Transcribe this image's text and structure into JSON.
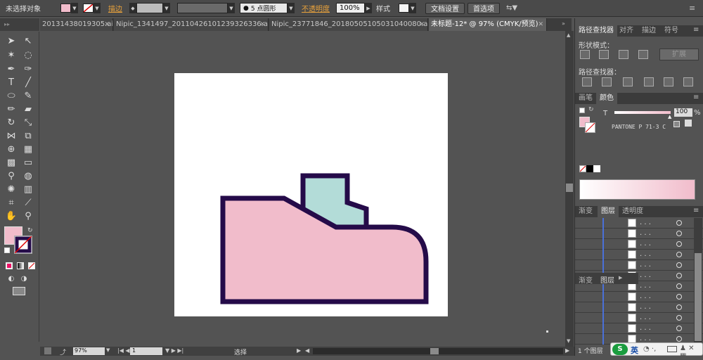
{
  "control_bar": {
    "selection": "未选择对象",
    "stroke_label": "描边",
    "brush": "5 点圆形",
    "opacity_label": "不透明度",
    "opacity_value": "100%",
    "style_label": "样式",
    "doc_settings": "文档设置",
    "preferences": "首选项"
  },
  "tabs": [
    {
      "label": "20131438019305.ai*"
    },
    {
      "label": "Nipic_1341497_20110426101239326336.ai*"
    },
    {
      "label": "Nipic_23771846_20180505105031040080.ai*"
    },
    {
      "label": "未标题-12* @ 97% (CMYK/预览)"
    }
  ],
  "status": {
    "zoom": "97%",
    "artboard": "1",
    "tool": "选择"
  },
  "panels": {
    "pathfinder": {
      "tabs": [
        "路径查找器",
        "对齐",
        "描边",
        "符号"
      ],
      "shape_modes": "形状模式：",
      "expand": "扩展",
      "pathfinders": "路径查找器："
    },
    "color": {
      "tabs": [
        "画笔",
        "颜色"
      ],
      "tint_label": "T",
      "tint_value": "100",
      "percent": "%",
      "swatch_name": "PANTONE P 71-3 C"
    },
    "layers": {
      "tabs": [
        "渐变",
        "图层",
        "透明度"
      ],
      "ghost_tabs": [
        "渐变",
        "图层"
      ],
      "count": "1 个图层",
      "row_text": ". . ."
    }
  },
  "ime": {
    "logo": "S",
    "lang": "英"
  },
  "colors": {
    "fill": "#f1bccb",
    "stroke": "#250b49",
    "boot": "#f1bccb",
    "top": "#b3dcd8"
  }
}
